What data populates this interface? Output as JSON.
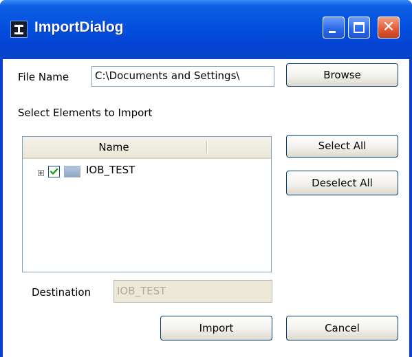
{
  "window": {
    "title": "ImportDialog"
  },
  "file": {
    "label": "File Name",
    "value": "C:\\Documents and Settings\\",
    "browse_label": "Browse"
  },
  "select_elements": {
    "label": "Select Elements to Import"
  },
  "tree": {
    "column_name": "Name",
    "items": [
      {
        "label": "IOB_TEST",
        "checked": true,
        "expanded": false
      }
    ]
  },
  "buttons": {
    "select_all": "Select All",
    "deselect_all": "Deselect All",
    "import": "Import",
    "cancel": "Cancel"
  },
  "destination": {
    "label": "Destination",
    "value": "IOB_TEST"
  },
  "colors": {
    "titlebar": "#0550e0",
    "close_button": "#e35d37",
    "checkbox_tick": "#21a121"
  }
}
